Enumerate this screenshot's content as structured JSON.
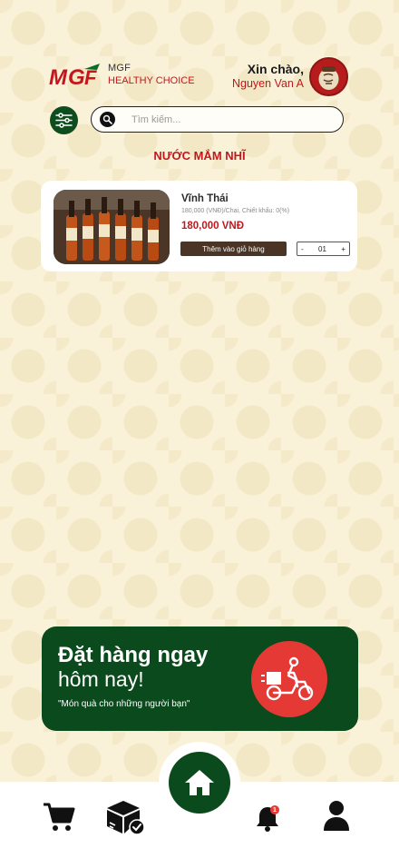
{
  "brand": {
    "name": "MGF",
    "tagline": "HEALTHY CHOICE"
  },
  "greeting": {
    "hello": "Xin chào,",
    "user_name": "Nguyen Van A"
  },
  "search": {
    "placeholder": "Tìm kiếm..."
  },
  "section": {
    "title": "NƯỚC MẮM NHĨ"
  },
  "products": [
    {
      "name": "Vĩnh Thái",
      "meta": "180,000 (VNĐ)/Chai, Chiết khấu: 0(%)",
      "price": "180,000 VNĐ",
      "add_to_cart_label": "Thêm vào giỏ hàng",
      "quantity": "01",
      "minus_label": "-",
      "plus_label": "+"
    }
  ],
  "banner": {
    "line1": "Đặt hàng ngay",
    "line2": "hôm nay!",
    "quote": "\"Món quà cho những người bạn\""
  },
  "nav": {
    "items": [
      "cart-icon",
      "orders-box-icon",
      "home-icon",
      "bell-icon",
      "user-icon"
    ],
    "notification_count": "1"
  },
  "colors": {
    "brand_red": "#c4161c",
    "brand_green": "#0b4a1d",
    "background": "#faf2d8",
    "button_brown": "#4a3425"
  }
}
